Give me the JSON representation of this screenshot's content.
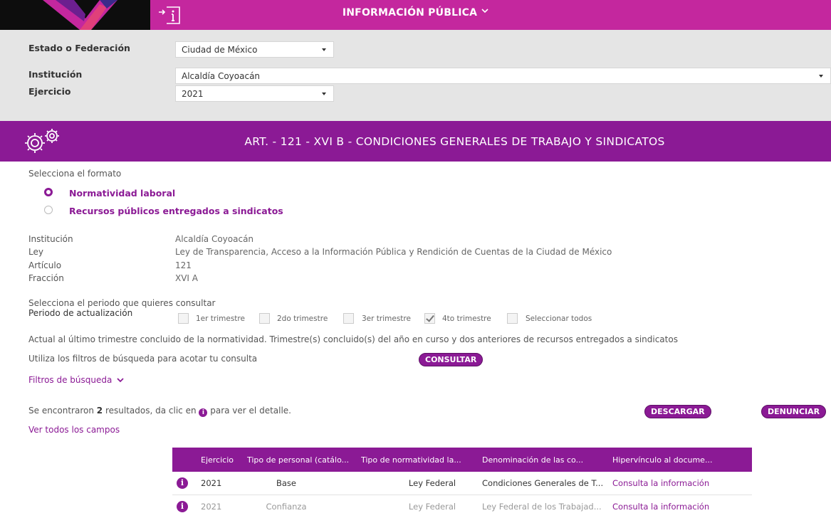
{
  "header": {
    "title": "INFORMACIÓN PÚBLICA"
  },
  "filters": {
    "estado": {
      "label": "Estado o Federación",
      "value": "Ciudad de México"
    },
    "institucion": {
      "label": "Institución",
      "value": "Alcaldía Coyoacán"
    },
    "ejercicio": {
      "label": "Ejercicio",
      "value": "2021"
    }
  },
  "section": {
    "title": "ART. - 121 - XVI B - CONDICIONES GENERALES DE TRABAJO Y SINDICATOS"
  },
  "formato": {
    "label": "Selecciona el formato",
    "options": [
      {
        "label": "Normatividad laboral",
        "selected": true
      },
      {
        "label": "Recursos públicos entregados a sindicatos",
        "selected": false
      }
    ]
  },
  "meta": [
    {
      "key": "Institución",
      "value": "Alcaldía Coyoacán"
    },
    {
      "key": "Ley",
      "value": "Ley de Transparencia, Acceso a la Información Pública y Rendición de Cuentas de la Ciudad de México"
    },
    {
      "key": "Artículo",
      "value": "121"
    },
    {
      "key": "Fracción",
      "value": "XVI A"
    }
  ],
  "periodo": {
    "prompt": "Selecciona el periodo que quieres consultar",
    "label": "Periodo de actualización",
    "options": [
      {
        "label": "1er trimestre",
        "checked": false
      },
      {
        "label": "2do trimestre",
        "checked": false
      },
      {
        "label": "3er trimestre",
        "checked": false
      },
      {
        "label": "4to trimestre",
        "checked": true
      },
      {
        "label": "Seleccionar todos",
        "checked": false
      }
    ]
  },
  "notes": {
    "actual": "Actual al último trimestre concluido de la normatividad. Trimestre(s) concluido(s) del año en curso y dos anteriores de recursos entregados a sindicatos",
    "filtros_hint": "Utiliza los filtros de búsqueda para acotar tu consulta",
    "consultar_btn": "CONSULTAR",
    "filtros_link": "Filtros de búsqueda"
  },
  "results": {
    "prefix": "Se encontraron",
    "count": "2",
    "middle": "resultados, da clic en",
    "suffix": "para ver el detalle.",
    "download_btn": "DESCARGAR",
    "report_btn": "DENUNCIAR",
    "all_fields_link": "Ver todos los campos"
  },
  "table": {
    "columns": [
      "Ejercicio",
      "Tipo de personal (catálo...",
      "Tipo de normatividad la...",
      "Denominación de las co...",
      "Hipervínculo al docume..."
    ],
    "rows": [
      [
        "2021",
        "Base",
        "Ley Federal",
        "Condiciones Generales de T...",
        "Consulta la información"
      ],
      [
        "2021",
        "Confianza",
        "Ley Federal",
        "Ley Federal de los Trabajad...",
        "Consulta la información"
      ]
    ]
  },
  "colors": {
    "magenta": "#c4279e",
    "purple": "#8b1a95",
    "panel_gray": "#e5e5e5"
  }
}
